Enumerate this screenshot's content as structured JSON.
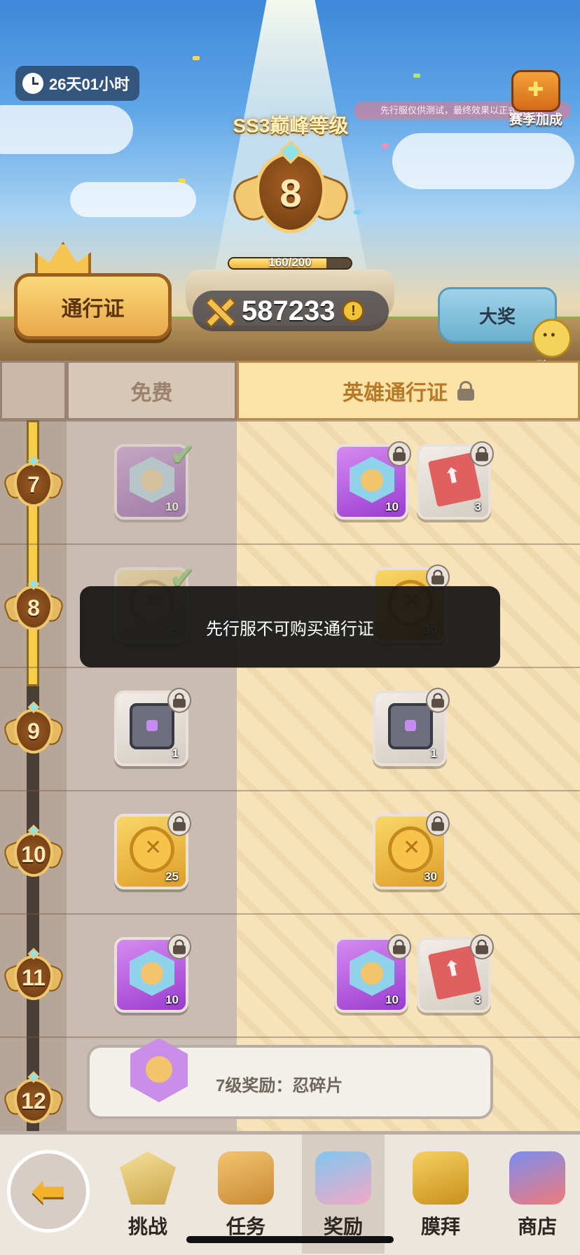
{
  "header": {
    "timer": "26天01小时",
    "season_label": "SS3巅峰等级",
    "season_bonus_label": "赛季加成",
    "notice_banner": "先行服仅供测试，最终效果以正式服为准",
    "rank": "8",
    "xp": {
      "current": 160,
      "max": 200,
      "text": "160/200",
      "fill_fraction": 0.8
    },
    "pass_button": "通行证",
    "currency_amount": "587233",
    "grand_prize": "大奖",
    "chat": "聊天"
  },
  "tabs": {
    "free": "免费",
    "hero_pass": "英雄通行证"
  },
  "rows": [
    {
      "level": "7",
      "free": [
        {
          "type": "shard",
          "qty": "10",
          "state": "claimed"
        }
      ],
      "hero": [
        {
          "type": "shard",
          "qty": "10",
          "state": "locked"
        },
        {
          "type": "ticket",
          "qty": "3",
          "state": "locked"
        }
      ]
    },
    {
      "level": "8",
      "free": [
        {
          "type": "coin",
          "qty": "25",
          "state": "claimed"
        }
      ],
      "hero": [
        {
          "type": "coin",
          "qty": "30",
          "state": "locked"
        }
      ]
    },
    {
      "level": "9",
      "free": [
        {
          "type": "chest",
          "qty": "1",
          "state": "locked"
        }
      ],
      "hero": [
        {
          "type": "chest",
          "qty": "1",
          "state": "locked"
        }
      ]
    },
    {
      "level": "10",
      "free": [
        {
          "type": "coin",
          "qty": "25",
          "state": "locked"
        }
      ],
      "hero": [
        {
          "type": "coin",
          "qty": "30",
          "state": "locked"
        }
      ]
    },
    {
      "level": "11",
      "free": [
        {
          "type": "shard",
          "qty": "10",
          "state": "locked"
        }
      ],
      "hero": [
        {
          "type": "shard",
          "qty": "10",
          "state": "locked"
        },
        {
          "type": "ticket",
          "qty": "3",
          "state": "locked"
        }
      ]
    },
    {
      "level": "12",
      "free": [],
      "hero": []
    }
  ],
  "toast": "先行服不可购买通行证",
  "reward_tip": "7级奖励：忍碎片",
  "nav": {
    "back_icon": "back-arrow-icon",
    "items": [
      {
        "label": "挑战",
        "icon": "challenge-icon",
        "active": false
      },
      {
        "label": "任务",
        "icon": "tasks-icon",
        "active": false
      },
      {
        "label": "奖励",
        "icon": "rewards-icon",
        "active": true
      },
      {
        "label": "膜拜",
        "icon": "worship-icon",
        "active": false
      },
      {
        "label": "商店",
        "icon": "shop-icon",
        "active": false
      }
    ]
  },
  "colors": {
    "accent_gold": "#f3c437",
    "hero_column": "#f6e3ba",
    "free_column": "#c9bcb2",
    "toast_bg": "#141414"
  }
}
